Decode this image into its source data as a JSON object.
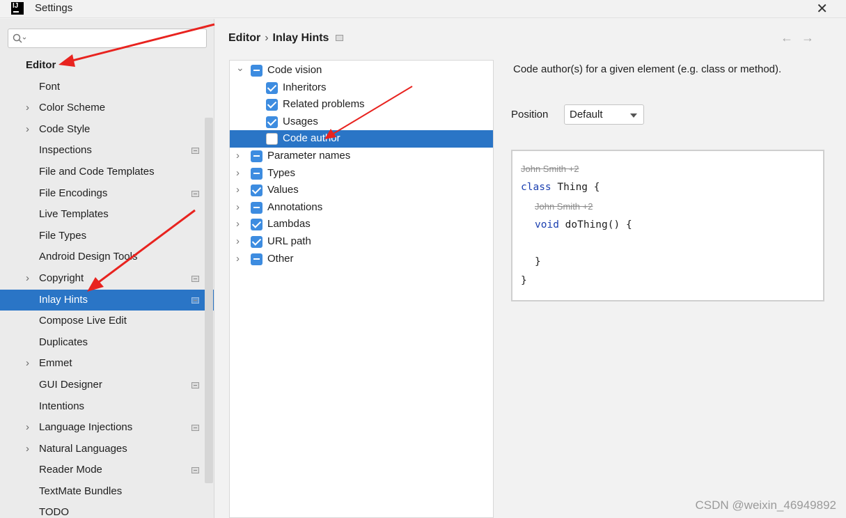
{
  "window": {
    "title": "Settings",
    "app_icon_text": "IJ"
  },
  "search": {
    "placeholder": "",
    "value": ""
  },
  "sidebar": {
    "items": [
      {
        "label": "Editor",
        "header": true,
        "expandable": false,
        "has_config": false
      },
      {
        "label": "Font",
        "expandable": false,
        "has_config": false
      },
      {
        "label": "Color Scheme",
        "expandable": true,
        "has_config": false
      },
      {
        "label": "Code Style",
        "expandable": true,
        "has_config": false
      },
      {
        "label": "Inspections",
        "expandable": false,
        "has_config": true
      },
      {
        "label": "File and Code Templates",
        "expandable": false,
        "has_config": false
      },
      {
        "label": "File Encodings",
        "expandable": false,
        "has_config": true
      },
      {
        "label": "Live Templates",
        "expandable": false,
        "has_config": false
      },
      {
        "label": "File Types",
        "expandable": false,
        "has_config": false
      },
      {
        "label": "Android Design Tools",
        "expandable": false,
        "has_config": false
      },
      {
        "label": "Copyright",
        "expandable": true,
        "has_config": true
      },
      {
        "label": "Inlay Hints",
        "expandable": false,
        "has_config": true,
        "selected": true
      },
      {
        "label": "Compose Live Edit",
        "expandable": false,
        "has_config": false
      },
      {
        "label": "Duplicates",
        "expandable": false,
        "has_config": false
      },
      {
        "label": "Emmet",
        "expandable": true,
        "has_config": false
      },
      {
        "label": "GUI Designer",
        "expandable": false,
        "has_config": true
      },
      {
        "label": "Intentions",
        "expandable": false,
        "has_config": false
      },
      {
        "label": "Language Injections",
        "expandable": true,
        "has_config": true
      },
      {
        "label": "Natural Languages",
        "expandable": true,
        "has_config": false
      },
      {
        "label": "Reader Mode",
        "expandable": false,
        "has_config": true
      },
      {
        "label": "TextMate Bundles",
        "expandable": false,
        "has_config": false
      },
      {
        "label": "TODO",
        "expandable": false,
        "has_config": false
      }
    ]
  },
  "breadcrumb": {
    "parent": "Editor",
    "separator": "›",
    "current": "Inlay Hints"
  },
  "nav": {
    "back": "←",
    "forward": "→"
  },
  "tree": {
    "rows": [
      {
        "label": "Code vision",
        "level": 0,
        "expandable": true,
        "expanded": true,
        "state": "partial"
      },
      {
        "label": "Inheritors",
        "level": 1,
        "expandable": false,
        "state": "checked"
      },
      {
        "label": "Related problems",
        "level": 1,
        "expandable": false,
        "state": "checked"
      },
      {
        "label": "Usages",
        "level": 1,
        "expandable": false,
        "state": "checked"
      },
      {
        "label": "Code author",
        "level": 1,
        "expandable": false,
        "state": "empty",
        "selected": true
      },
      {
        "label": "Parameter names",
        "level": 0,
        "expandable": true,
        "expanded": false,
        "state": "partial"
      },
      {
        "label": "Types",
        "level": 0,
        "expandable": true,
        "expanded": false,
        "state": "partial"
      },
      {
        "label": "Values",
        "level": 0,
        "expandable": true,
        "expanded": false,
        "state": "checked"
      },
      {
        "label": "Annotations",
        "level": 0,
        "expandable": true,
        "expanded": false,
        "state": "partial"
      },
      {
        "label": "Lambdas",
        "level": 0,
        "expandable": true,
        "expanded": false,
        "state": "checked"
      },
      {
        "label": "URL path",
        "level": 0,
        "expandable": true,
        "expanded": false,
        "state": "checked"
      },
      {
        "label": "Other",
        "level": 0,
        "expandable": true,
        "expanded": false,
        "state": "partial"
      }
    ]
  },
  "detail": {
    "description": "Code author(s) for a given element (e.g. class or method).",
    "position_label": "Position",
    "position_value": "Default",
    "preview": {
      "hint1": "John Smith +2",
      "line1_kw": "class",
      "line1_rest": " Thing {",
      "hint2": "John Smith +2",
      "line2_kw": "void",
      "line2_rest": " doThing() {",
      "line3": "}",
      "line4": "}"
    }
  },
  "watermark": "CSDN @weixin_46949892",
  "colors": {
    "selection": "#2a75c6",
    "checkbox": "#3d8ce0",
    "annotation_arrow": "#e8231f",
    "keyword": "#1a3fb0"
  }
}
